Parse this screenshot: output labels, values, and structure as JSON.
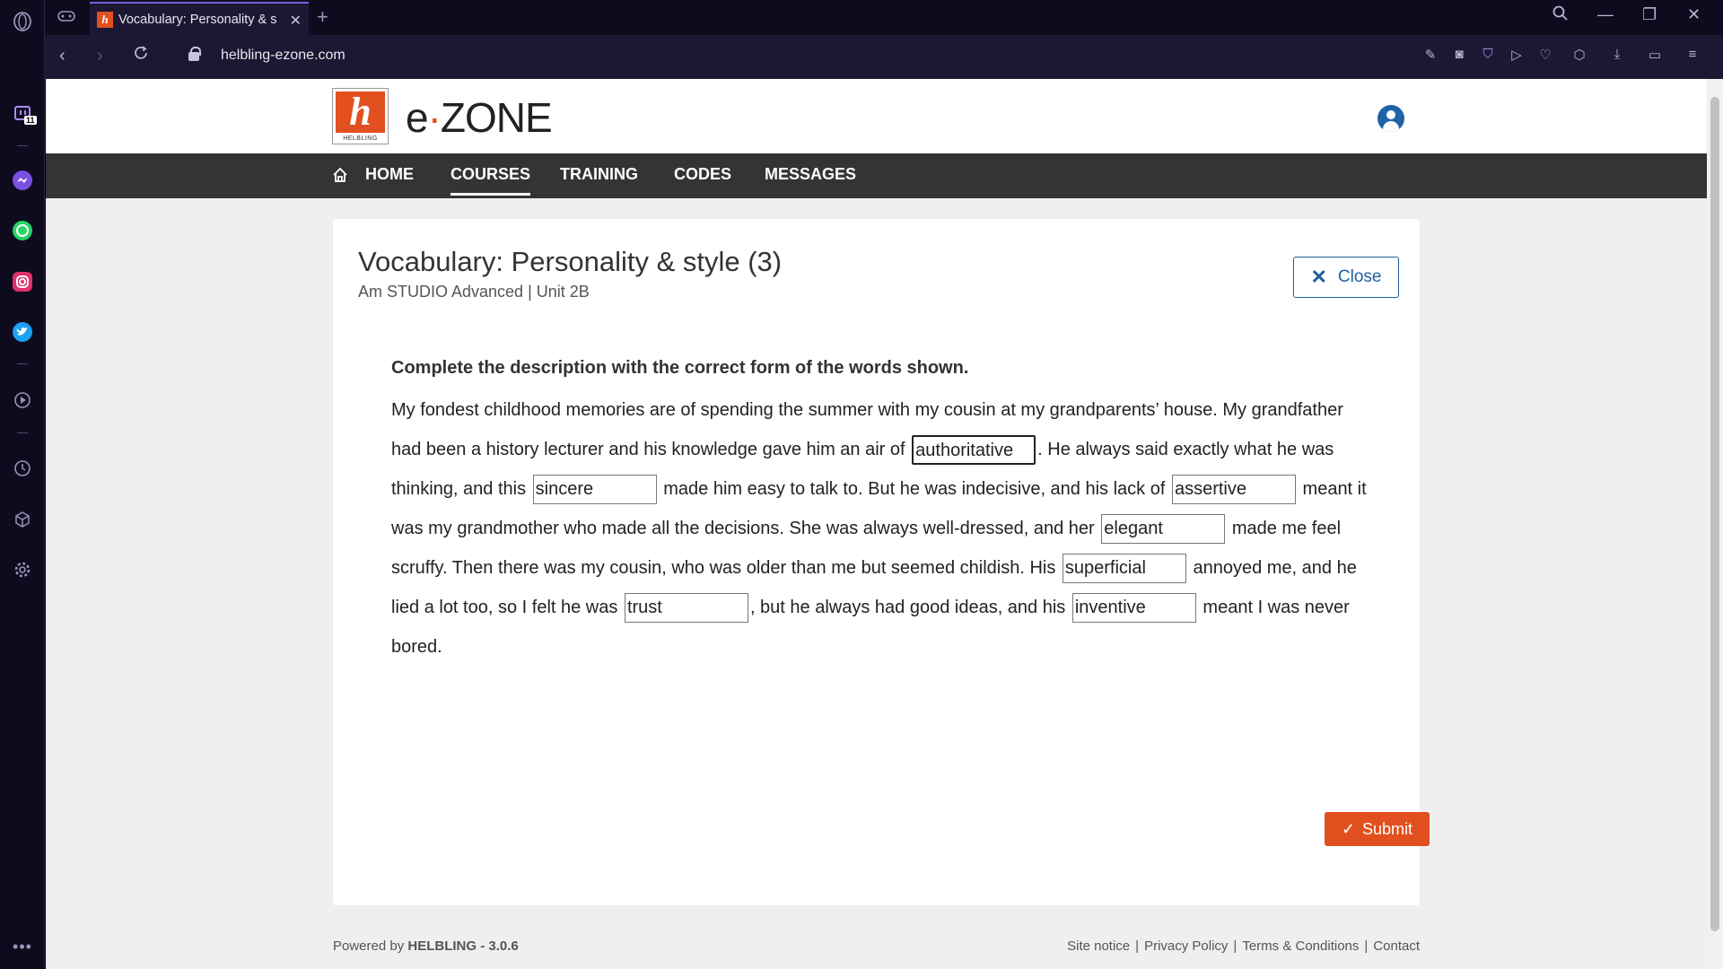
{
  "browser": {
    "tab_title": "Vocabulary: Personality & s",
    "url": "helbling-ezone.com",
    "sidebar_badge": "11"
  },
  "site": {
    "logo_text": "HELBLING",
    "brand": {
      "prefix": "e",
      "dot": "·",
      "suffix": "ZONE"
    },
    "nav": {
      "home": "HOME",
      "courses": "COURSES",
      "training": "TRAINING",
      "codes": "CODES",
      "messages": "MESSAGES",
      "active": "COURSES"
    }
  },
  "exercise": {
    "title": "Vocabulary: Personality & style (3)",
    "subtitle": "Am STUDIO Advanced | Unit 2B",
    "close_label": "Close",
    "instruction": "Complete the description with the correct form of the words shown.",
    "text": {
      "t1": "My fondest childhood memories are of spending the summer with my cousin at my grandparents’ house. My grandfather had been a history lecturer and his knowledge gave him an air of",
      "t2": ". He always said exactly what he was thinking, and this",
      "t3": "made him easy to talk to. But he was indecisive, and his lack of",
      "t4": "meant it was my grandmother who made all the decisions. She was always well-dressed, and her",
      "t5": "made me feel scruffy. Then there was my cousin, who was older than me but seemed childish. His",
      "t6": "annoyed me, and he lied a lot too, so I felt he was",
      "t7": ", but he always had good ideas, and his",
      "t8": "meant I was never bored."
    },
    "gaps": {
      "g1": "authoritative",
      "g2": "sincere",
      "g3": "assertive",
      "g4": "elegant",
      "g5": "superficial",
      "g6": "trust",
      "g7": "inventive"
    },
    "submit_label": "Submit"
  },
  "footer": {
    "powered_prefix": "Powered by",
    "powered_brand": "HELBLING - 3.0.6",
    "links": {
      "site_notice": "Site notice",
      "privacy": "Privacy Policy",
      "terms": "Terms & Conditions",
      "contact": "Contact"
    }
  },
  "colors": {
    "accent_orange": "#e2501f",
    "link_blue": "#1e5fa0",
    "nav_bg": "#343434"
  }
}
